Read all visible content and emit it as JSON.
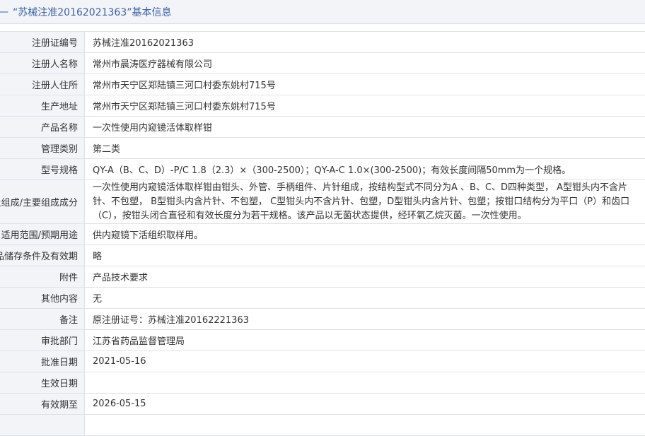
{
  "header": {
    "dash": "—",
    "title": "“苏械注准20162021363”基本信息"
  },
  "rows": [
    {
      "label": "注册证编号",
      "value": "苏械注准20162021363"
    },
    {
      "label": "注册人名称",
      "value": "常州市晨涛医疗器械有限公司"
    },
    {
      "label": "注册人住所",
      "value": "常州市天宁区郑陆镇三河口村委东姚村715号"
    },
    {
      "label": "生产地址",
      "value": "常州市天宁区郑陆镇三河口村委东姚村715号"
    },
    {
      "label": "产品名称",
      "value": "一次性使用内窥镜活体取样钳"
    },
    {
      "label": "管理类别",
      "value": "第二类"
    },
    {
      "label": "型号规格",
      "value": "QY-A（B、C、D）-P/C 1.8（2.3）×（300-2500）；QY-A-C 1.0×(300-2500)；有效长度间隔50mm为一个规格。"
    },
    {
      "label": "结构及组成/主要组成成分",
      "value": "一次性使用内窥镜活体取样钳由钳头、外管、手柄组件、片针组成，按结构型式不同分为A 、B、C、D四种类型， A型钳头内不含片针、不包塑， B型钳头内含片针、不包塑， C型钳头内不含片针、包塑，D型钳头内含片针、包塑；按钳口结构分为平口（P）和齿口（C），按钳头闭合直径和有效长度分为若干规格。该产品以无菌状态提供，经环氧乙烷灭菌。一次性使用。"
    },
    {
      "label": "适用范围/预期用途",
      "value": "供内窥镜下活组织取样用。"
    },
    {
      "label": "产品储存条件及有效期",
      "value": "略"
    },
    {
      "label": "附件",
      "value": "产品技术要求"
    },
    {
      "label": "其他内容",
      "value": "无"
    },
    {
      "label": "备注",
      "value": "原注册证号：苏械注准20162221363"
    },
    {
      "label": "审批部门",
      "value": "江苏省药品监督管理局"
    },
    {
      "label": "批准日期",
      "value": "2021-05-16"
    },
    {
      "label": "生效日期",
      "value": ""
    },
    {
      "label": "有效期至",
      "value": "2026-05-15"
    },
    {
      "label": "",
      "value": ""
    }
  ],
  "colors": {
    "accent": "#3a62a8",
    "label_bg": "#f2f4f8",
    "border": "#dde2ea"
  }
}
